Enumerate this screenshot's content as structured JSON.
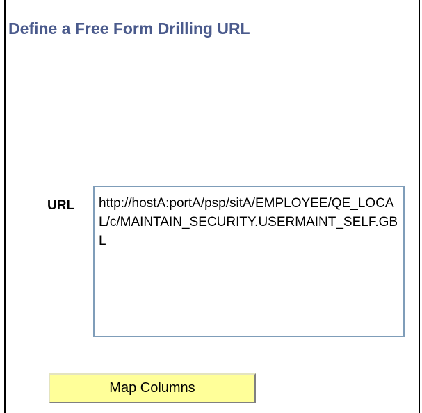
{
  "page": {
    "title": "Define a Free Form Drilling URL"
  },
  "form": {
    "url_label": "URL",
    "url_value": "http://hostA:portA/psp/sitA/EMPLOYEE/QE_LOCAL/c/MAINTAIN_SECURITY.USERMAINT_SELF.GBL"
  },
  "actions": {
    "map_columns_label": "Map Columns"
  },
  "colors": {
    "title": "#4a5a8c",
    "button_bg": "#ffff99",
    "field_border": "#7f9db9"
  }
}
